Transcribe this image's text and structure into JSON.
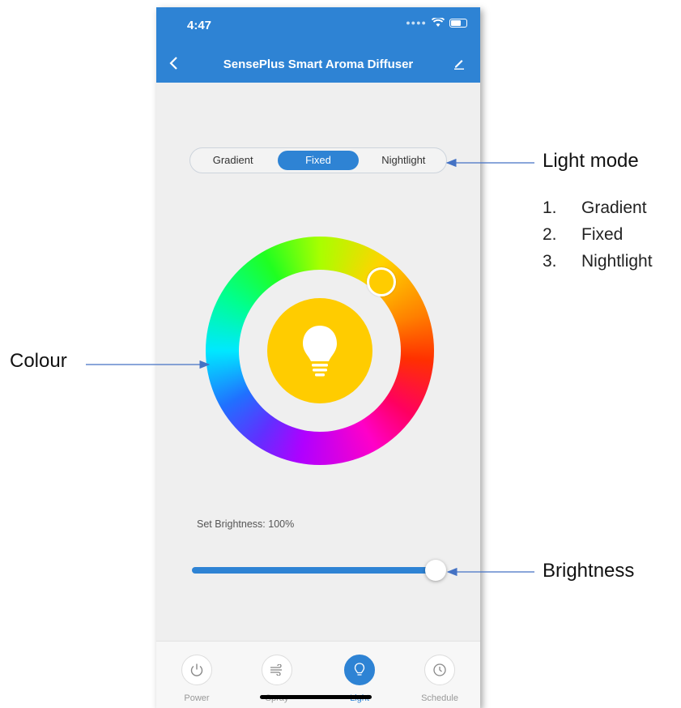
{
  "status_bar": {
    "time": "4:47"
  },
  "header": {
    "title": "SensePlus Smart Aroma Diffuser",
    "back_icon": "chevron-left-icon",
    "edit_icon": "pencil-icon"
  },
  "light_mode": {
    "options": [
      "Gradient",
      "Fixed",
      "Nightlight"
    ],
    "selected": "Fixed"
  },
  "color_wheel": {
    "selected_color": "#ffcc00",
    "center_icon": "lightbulb-icon"
  },
  "brightness": {
    "label": "Set Brightness: 100%",
    "value_percent": 100
  },
  "bottom_nav": {
    "items": [
      {
        "label": "Power",
        "icon": "power-icon"
      },
      {
        "label": "Spray",
        "icon": "wind-icon"
      },
      {
        "label": "Light",
        "icon": "lightbulb-icon",
        "active": true
      },
      {
        "label": "Schedule",
        "icon": "clock-icon"
      }
    ]
  },
  "annotations": {
    "light_mode": "Light mode",
    "colour": "Colour",
    "brightness": "Brightness",
    "modes_list": [
      {
        "num": "1.",
        "text": "Gradient"
      },
      {
        "num": "2.",
        "text": "Fixed"
      },
      {
        "num": "3.",
        "text": "Nightlight"
      }
    ]
  },
  "colors": {
    "accent": "#2e83d4",
    "bulb": "#ffcc00",
    "background": "#efefef",
    "annotation_arrow": "#4472c4"
  }
}
